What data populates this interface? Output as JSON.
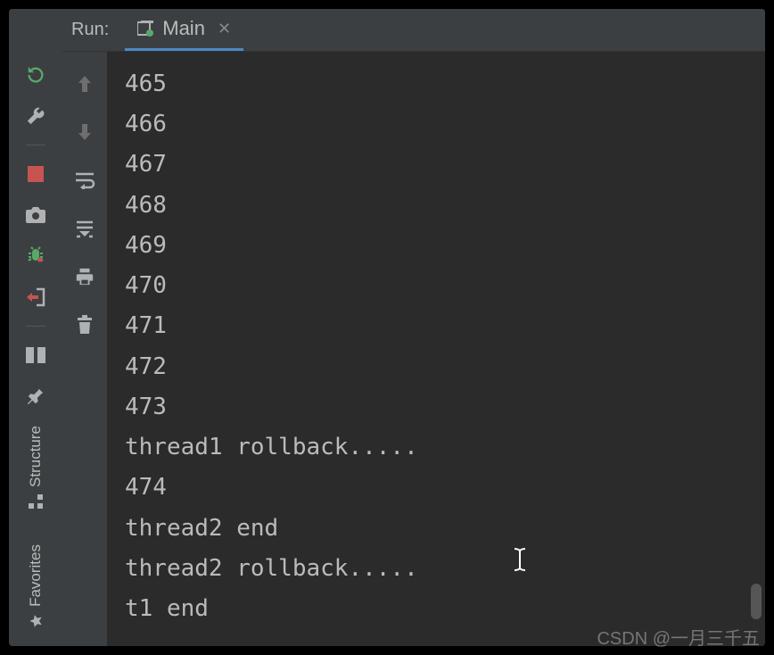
{
  "header": {
    "run_label": "Run:",
    "tab_label": "Main"
  },
  "sidebar": {
    "structure_label": "Structure",
    "favorites_label": "Favorites"
  },
  "console": {
    "lines": [
      "465",
      "466",
      "467",
      "468",
      "469",
      "470",
      "471",
      "472",
      "473",
      "thread1 rollback.....",
      "474",
      "thread2 end",
      "thread2 rollback.....",
      "t1 end"
    ]
  },
  "watermark": "CSDN @一月三千五"
}
